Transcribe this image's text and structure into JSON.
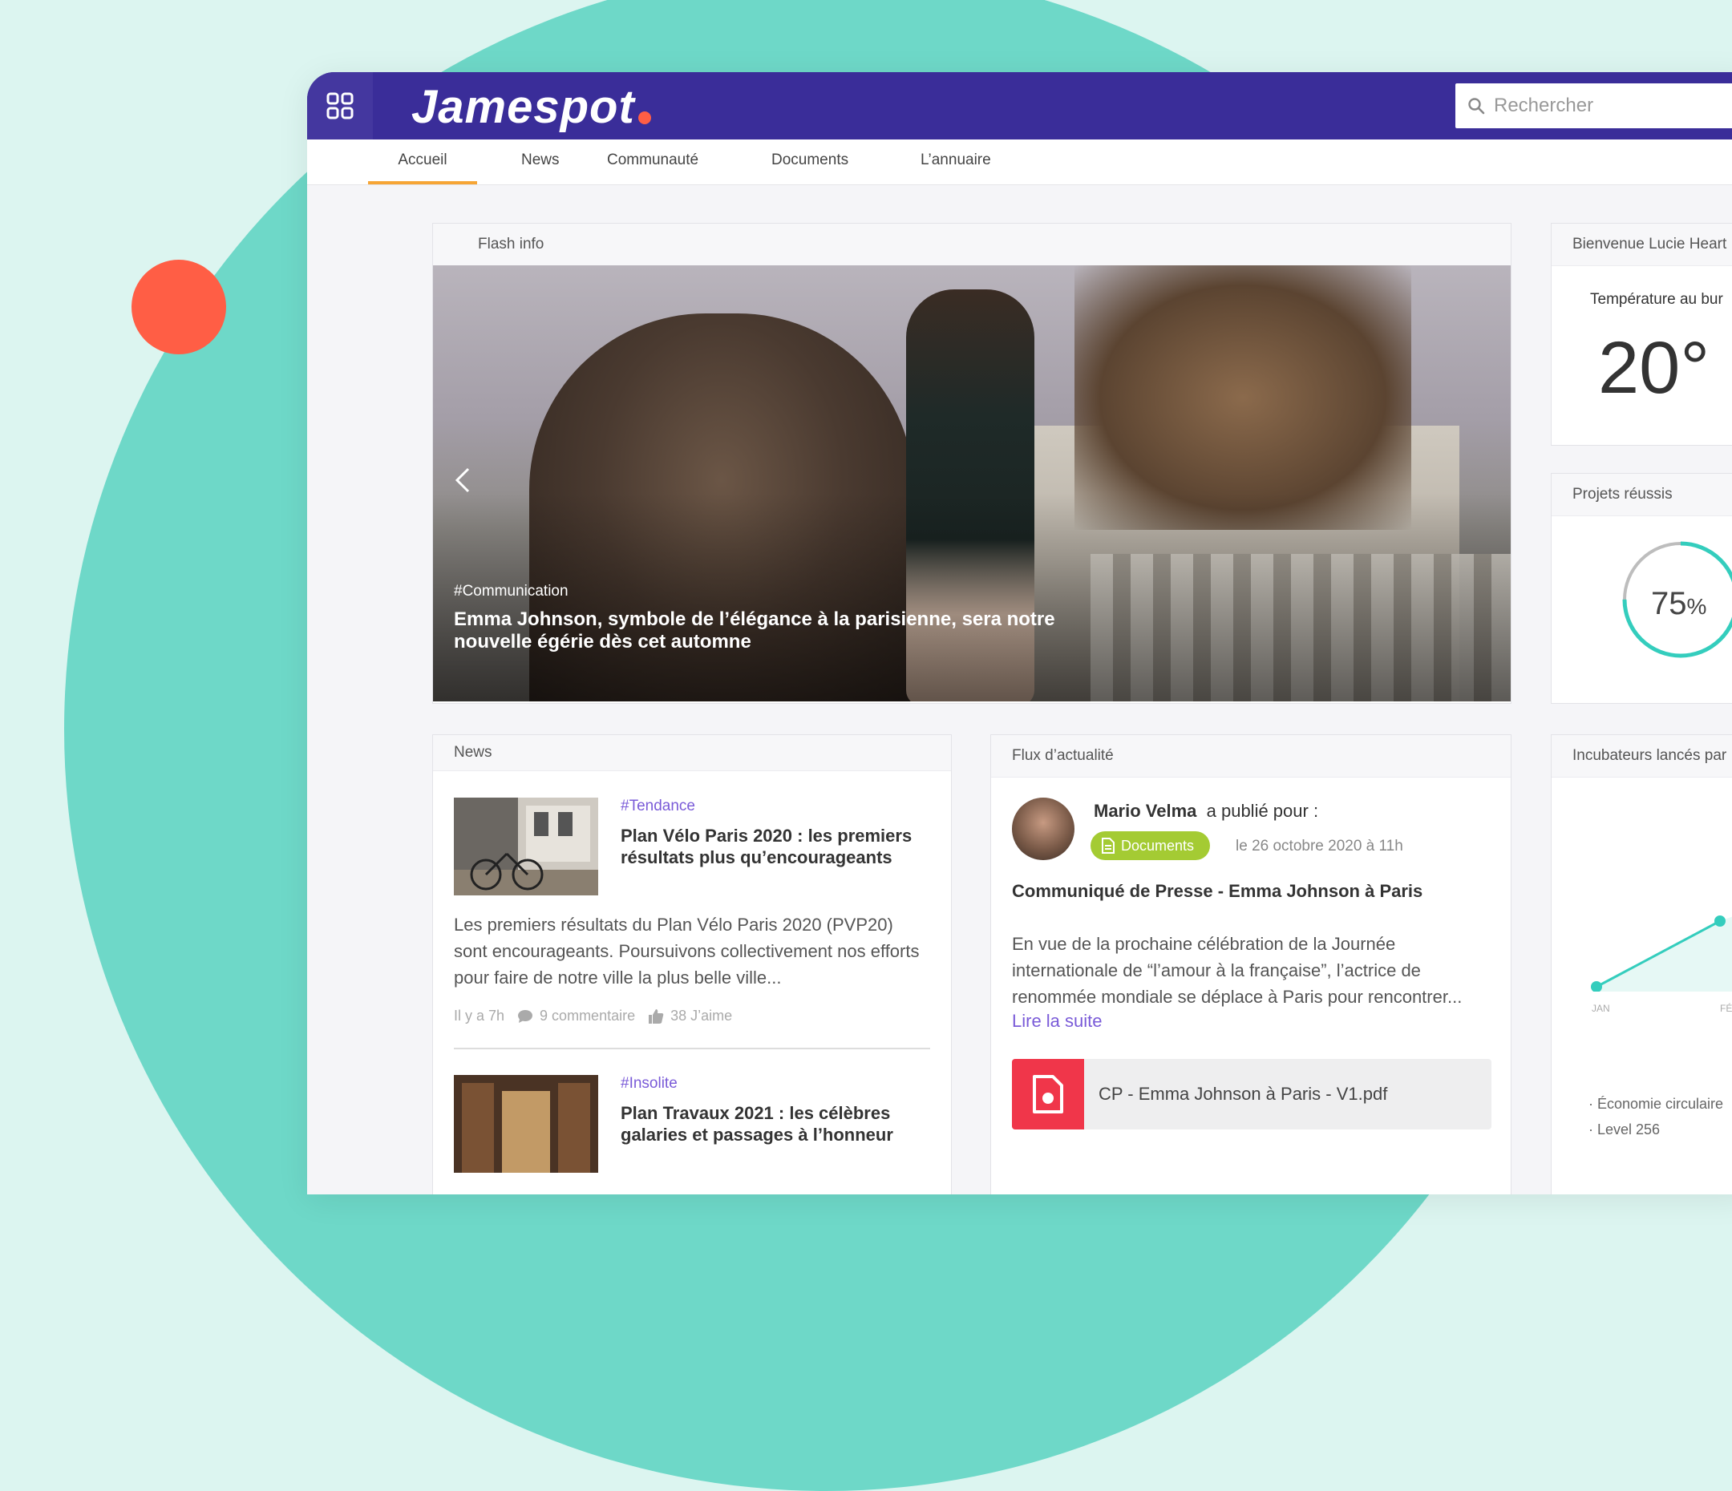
{
  "header": {
    "logo_text": "Jamespot",
    "search_placeholder": "Rechercher",
    "accent": "#ff5e45",
    "bar_color": "#3a2d99"
  },
  "nav": [
    {
      "label": "Accueil",
      "active": true
    },
    {
      "label": "News"
    },
    {
      "label": "Communauté"
    },
    {
      "label": "Documents"
    },
    {
      "label": "L’annuaire"
    }
  ],
  "flash": {
    "heading": "Flash info",
    "tag": "#Communication",
    "title": "Emma Johnson, symbole de l’élégance à la parisienne, sera notre nouvelle égérie dès cet automne"
  },
  "news": {
    "heading": "News",
    "items": [
      {
        "tag": "#Tendance",
        "title": "Plan Vélo Paris 2020 : les premiers résultats plus qu’encourageants",
        "body": "Les premiers résultats du Plan Vélo Paris 2020 (PVP20) sont encourageants. Poursuivons collectivement nos efforts  pour faire de notre ville la plus belle ville...",
        "time": "Il y a 7h",
        "comments": "9 commentaire",
        "likes": "38 J’aime"
      },
      {
        "tag": "#Insolite",
        "title": "Plan Travaux 2021 : les célèbres galaries et passages à l’honneur"
      }
    ]
  },
  "feed": {
    "heading": "Flux d’actualité",
    "author": "Mario Velma",
    "action": "a publié pour :",
    "category": "Documents",
    "date": "le 26 octobre 2020 à 11h",
    "title": "Communiqué de Presse - Emma Johnson à Paris",
    "body": "En vue de la prochaine célébration de la Journée internationale de “l’amour à la française”, l’actrice de renommée mondiale se déplace à Paris pour rencontrer...",
    "read_more": "Lire la suite",
    "file": "CP - Emma Johnson à Paris - V1.pdf"
  },
  "sidebar": {
    "welcome": "Bienvenue Lucie Heart",
    "temp_label": "Température au bur",
    "temp_value": "20°",
    "projects": "Projets réussis",
    "projects_value": "75",
    "projects_unit": "%",
    "incub": "Incubateurs lancés par",
    "chart_jan": "JAN",
    "chart_feb": "FÉ",
    "legend1": "· Économie circulaire",
    "legend2": "· Level 256"
  },
  "icons": [
    "apps-grid-icon",
    "search-icon",
    "chevron-left-icon",
    "comment-icon",
    "thumbs-up-icon",
    "document-icon",
    "pdf-file-icon"
  ]
}
